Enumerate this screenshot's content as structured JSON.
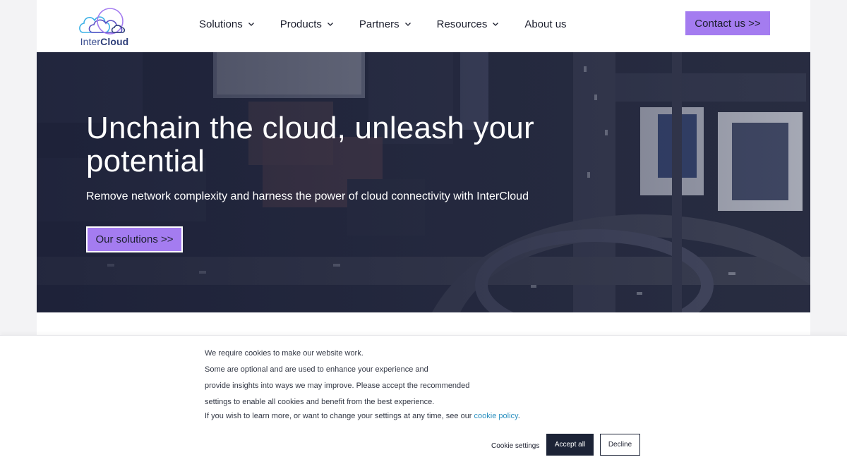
{
  "brand": {
    "logo_prefix": "Inter",
    "logo_suffix": "Cloud",
    "colors": {
      "accent": "#a47cf0",
      "dark": "#1c2336",
      "link": "#2a8fbf"
    }
  },
  "nav": {
    "items": [
      {
        "label": "Solutions",
        "has_dropdown": true
      },
      {
        "label": "Products",
        "has_dropdown": true
      },
      {
        "label": "Partners",
        "has_dropdown": true
      },
      {
        "label": "Resources",
        "has_dropdown": true
      },
      {
        "label": "About us",
        "has_dropdown": false
      }
    ],
    "contact_label": "Contact us >>"
  },
  "hero": {
    "title": "Unchain the cloud, unleash your potential",
    "subtitle": "Remove network complexity and harness the power of cloud connectivity with InterCloud",
    "cta_label": "Our solutions >>"
  },
  "cookie": {
    "lines": [
      "We require cookies to make our website work.",
      "Some are optional and are used to enhance your experience and",
      "provide insights into ways we may improve. Please accept the recommended",
      "settings to enable all cookies and benefit from the best experience."
    ],
    "more_text": "If you wish to learn more, or want to change your settings at any time, see our ",
    "policy_link": "cookie policy",
    "more_end": ".",
    "settings_label": "Cookie settings",
    "accept_label": "Accept all",
    "decline_label": "Decline"
  }
}
